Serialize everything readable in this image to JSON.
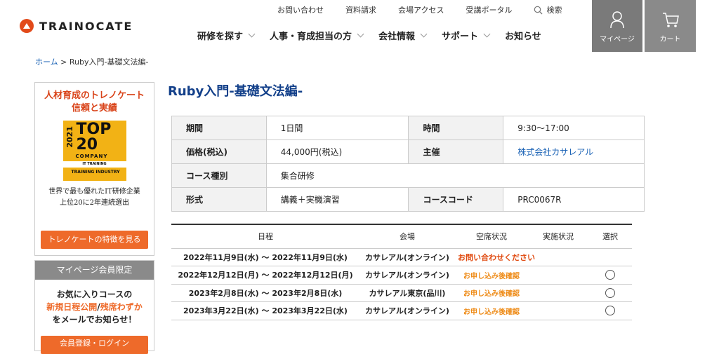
{
  "brand": {
    "name": "TRAINOCATE",
    "accent": "#e24a1a"
  },
  "utility_nav": [
    "お問い合わせ",
    "資料請求",
    "会場アクセス",
    "受講ポータル",
    "検索"
  ],
  "main_nav": [
    "研修を探す",
    "人事・育成担当の方",
    "会社情報",
    "サポート",
    "お知らせ"
  ],
  "mypage_label": "マイページ",
  "cart_label": "カート",
  "breadcrumb": {
    "home": "ホーム",
    "sep": ">",
    "current": "Ruby入門-基礎文法編-"
  },
  "sidebar": {
    "banner_title_1": "人材育成のトレノケート",
    "banner_title_2": "信頼と実績",
    "badge_year": "2021",
    "badge_top": "TOP",
    "badge_num": "20",
    "badge_company": "COMPANY",
    "badge_strip": "IT TRAINING",
    "badge_ti": "TRAINING INDUSTRY",
    "desc_1": "世界で最も優れたIT研修企業",
    "desc_2": "上位20に2年連続選出",
    "feature_button": "トレノケートの特徴を見る",
    "member_header": "マイページ会員限定",
    "member_line1": "お気に入りコースの",
    "member_orange_1": "新規日程公開",
    "member_slash": "/",
    "member_orange_2": "残席わずか",
    "member_line3": "をメールでお知らせ！",
    "login_button": "会員登録・ログイン"
  },
  "page_title": "Ruby入門-基礎文法編-",
  "info": {
    "period_label": "期間",
    "period": "1日間",
    "time_label": "時間",
    "time": "9:30〜17:00",
    "price_label": "価格(税込)",
    "price": "44,000円(税込)",
    "host_label": "主催",
    "host": "株式会社カサレアル",
    "type_label": "コース種別",
    "type": "集合研修",
    "format_label": "形式",
    "format": "講義＋実機演習",
    "code_label": "コースコード",
    "code": "PRC0067R"
  },
  "schedule": {
    "headers": [
      "日程",
      "会場",
      "空席状況",
      "実施状況",
      "選択"
    ],
    "rows": [
      {
        "date": "2022年11月9日(水) ～ 2022年11月9日(水)",
        "venue": "カサレアル(オンライン)",
        "status": "お問い合わせください"
      },
      {
        "date": "2022年12月12日(月) ～ 2022年12月12日(月)",
        "venue": "カサレアル(オンライン)",
        "status": "お申し込み後確認"
      },
      {
        "date": "2023年2月8日(水) ～ 2023年2月8日(水)",
        "venue": "カサレアル東京(品川)",
        "status": "お申し込み後確認"
      },
      {
        "date": "2023年3月22日(水) ～ 2023年3月22日(水)",
        "venue": "カサレアル(オンライン)",
        "status": "お申し込み後確認"
      }
    ]
  }
}
